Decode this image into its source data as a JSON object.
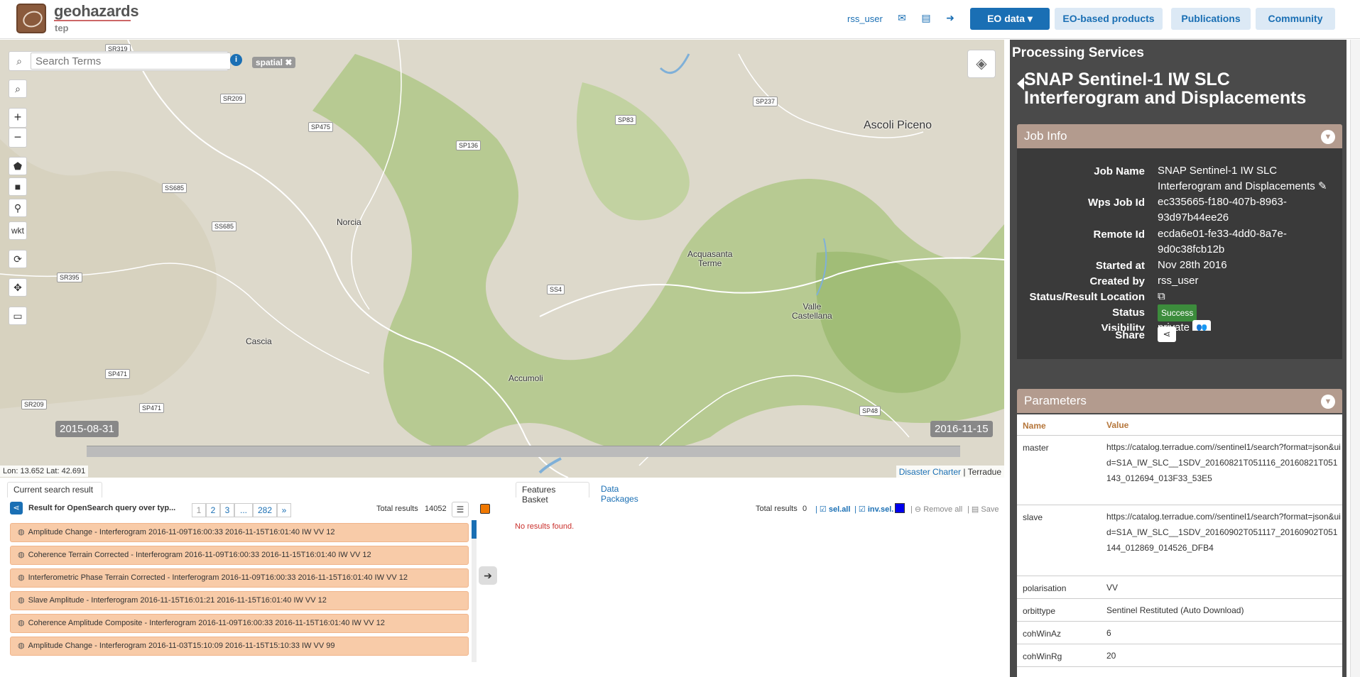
{
  "topbar": {
    "brand": "geohazards",
    "brand_sub": "tep",
    "user": "rss_user",
    "buttons": [
      "EO data",
      "EO-based products",
      "Publications",
      "Community"
    ],
    "colors": {
      "primary": "#1a6fb4",
      "secondary": "#dce9f5"
    }
  },
  "map": {
    "search_placeholder": "Search Terms",
    "spatial_tag": "spatial ✖",
    "tool_wkt": "wkt",
    "places": {
      "ascoli": "Ascoli Piceno",
      "norcia": "Norcia",
      "acquasanta": "Acquasanta\nTerme",
      "valle": "Valle\nCastellana",
      "cascia": "Cascia",
      "accumoli": "Accumoli"
    },
    "roads": [
      "SR319",
      "SR209",
      "SP475",
      "SP136",
      "SP83",
      "SP237",
      "SS685",
      "SS685",
      "SR395",
      "SS4",
      "SP471",
      "SP471",
      "SR209",
      "SP48"
    ],
    "time_start": "2015-08-31",
    "time_end": "2016-11-15",
    "coords": "Lon: 13.652 Lat: 42.691",
    "attribution_link": "Disaster Charter",
    "attribution_text": "Terradue"
  },
  "results": {
    "tab_current": "Current search result",
    "query_label": "Result for OpenSearch query over typ...",
    "pages": [
      "1",
      "2",
      "3",
      "...",
      "282",
      "»"
    ],
    "total_label": "Total results",
    "total": "14052",
    "items": [
      "Amplitude Change - Interferogram 2016-11-09T16:00:33 2016-11-15T16:01:40 IW VV 12",
      "Coherence Terrain Corrected - Interferogram 2016-11-09T16:00:33 2016-11-15T16:01:40 IW VV 12",
      "Interferometric Phase Terrain Corrected - Interferogram 2016-11-09T16:00:33 2016-11-15T16:01:40 IW VV 12",
      "Slave Amplitude - Interferogram 2016-11-15T16:01:21 2016-11-15T16:01:40 IW VV 12",
      "Coherence Amplitude Composite - Interferogram 2016-11-09T16:00:33 2016-11-15T16:01:40 IW VV 12",
      "Amplitude Change - Interferogram 2016-11-03T15:10:09 2016-11-15T15:10:33 IW VV 99"
    ]
  },
  "basket": {
    "tab_basket": "Features Basket",
    "tab_packages": "Data Packages",
    "total_label": "Total results",
    "total": "0",
    "sel_all": "sel.all",
    "inv_sel": "inv.sel.",
    "remove_all": "Remove all",
    "save": "Save",
    "empty": "No results found."
  },
  "panel": {
    "title": "Processing Services",
    "service_title": "SNAP Sentinel-1 IW SLC Interferogram and Displacements",
    "job_info": {
      "header": "Job Info",
      "labels": [
        "Job Name",
        "Wps Job Id",
        "Remote Id",
        "Started at",
        "Created by",
        "Status/Result Location",
        "Status",
        "Visibility",
        "Share"
      ],
      "job_name": "SNAP Sentinel-1 IW SLC Interferogram and Displacements",
      "wps_job_id": "ec335665-f180-407b-8963-93d97b44ee26",
      "remote_id": "ecda6e01-fe33-4dd0-8a7e-9d0c38fcb12b",
      "started_at": "Nov 28th 2016",
      "created_by": "rss_user",
      "status": "Success",
      "visibility": "private"
    },
    "parameters": {
      "header": "Parameters",
      "col_name": "Name",
      "col_value": "Value",
      "rows": [
        {
          "name": "master",
          "value": "https://catalog.terradue.com//sentinel1/search?format=json&uid=S1A_IW_SLC__1SDV_20160821T051116_20160821T051143_012694_013F33_53E5"
        },
        {
          "name": "slave",
          "value": "https://catalog.terradue.com//sentinel1/search?format=json&uid=S1A_IW_SLC__1SDV_20160902T051117_20160902T051144_012869_014526_DFB4"
        },
        {
          "name": "polarisation",
          "value": "VV"
        },
        {
          "name": "orbittype",
          "value": "Sentinel Restituted (Auto Download)"
        },
        {
          "name": "cohWinAz",
          "value": "6"
        },
        {
          "name": "cohWinRg",
          "value": "20"
        }
      ]
    }
  }
}
